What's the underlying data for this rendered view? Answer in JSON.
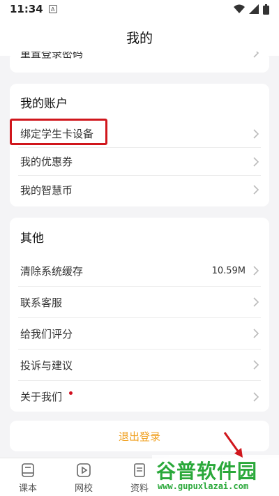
{
  "status_bar": {
    "time": "11:34",
    "sim_label": "A"
  },
  "header": {
    "title": "我的"
  },
  "top_card": {
    "partial_item": "重置登录密码"
  },
  "account": {
    "title": "我的账户",
    "items": [
      {
        "label": "绑定学生卡设备"
      },
      {
        "label": "我的优惠券"
      },
      {
        "label": "我的智慧币"
      }
    ]
  },
  "other": {
    "title": "其他",
    "items": [
      {
        "label": "清除系统缓存",
        "value": "10.59M"
      },
      {
        "label": "联系客服"
      },
      {
        "label": "给我们评分"
      },
      {
        "label": "投诉与建议"
      },
      {
        "label": "关于我们"
      }
    ]
  },
  "logout": {
    "label": "退出登录"
  },
  "tabs": [
    {
      "label": "课本",
      "icon": "book-icon"
    },
    {
      "label": "网校",
      "icon": "play-icon"
    },
    {
      "label": "资料",
      "icon": "document-icon"
    }
  ],
  "watermark": {
    "title": "谷普软件园",
    "url": "www.gupuxlazai.com"
  },
  "colors": {
    "accent": "#f0a020",
    "highlight": "#d0161c",
    "watermark": "#2aa83a",
    "badge": "#d20f1f"
  }
}
